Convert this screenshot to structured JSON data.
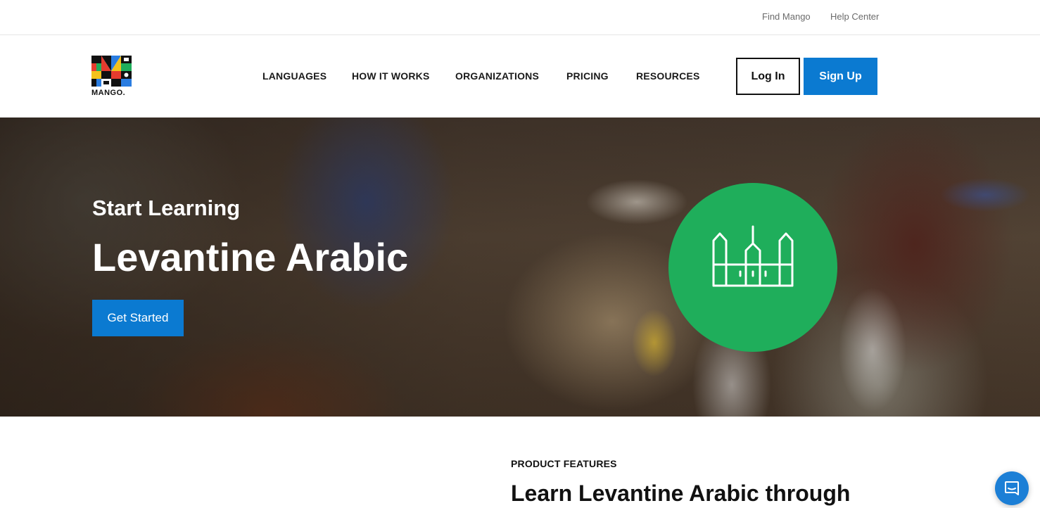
{
  "utility_bar": {
    "find_label": "Find Mango",
    "help_label": "Help Center"
  },
  "header": {
    "logo_text": "MANGO.",
    "nav": {
      "languages": "LANGUAGES",
      "how_it_works": "HOW IT WORKS",
      "organizations": "ORGANIZATIONS",
      "pricing": "PRICING",
      "resources": "RESOURCES"
    },
    "login_label": "Log In",
    "signup_label": "Sign Up"
  },
  "hero": {
    "subtitle": "Start Learning",
    "title": "Levantine Arabic",
    "cta_label": "Get Started",
    "icon": "mosque-icon",
    "circle_color": "#1fae5b"
  },
  "features": {
    "eyebrow": "PRODUCT FEATURES",
    "heading": "Learn Levantine Arabic through"
  },
  "chat": {
    "icon": "chat-icon"
  },
  "colors": {
    "accent": "#0b7ad1",
    "chat": "#1c7fd6"
  }
}
